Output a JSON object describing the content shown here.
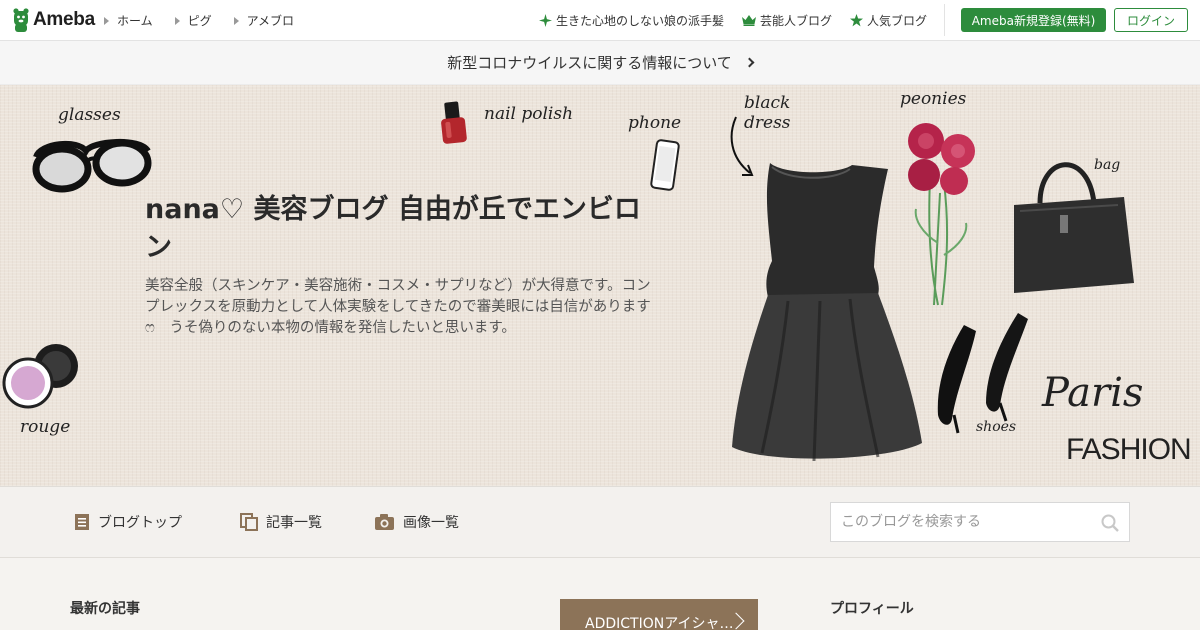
{
  "header": {
    "logo_text": "Ameba",
    "nav": [
      {
        "label": "ホーム"
      },
      {
        "label": "ピグ"
      },
      {
        "label": "アメブロ"
      }
    ],
    "right_links": [
      {
        "label": "生きた心地のしない娘の派手髪",
        "icon": "sparkle-icon"
      },
      {
        "label": "芸能人ブログ",
        "icon": "crown-icon"
      },
      {
        "label": "人気ブログ",
        "icon": "star-icon"
      }
    ],
    "register_label": "Ameba新規登録(無料)",
    "login_label": "ログイン"
  },
  "notice": {
    "text": "新型コロナウイルスに関する情報について"
  },
  "hero": {
    "title": "nana♡ 美容ブログ 自由が丘でエンビロン",
    "description": "美容全般（スキンケア・美容施術・コスメ・サプリなど）が大得意です。コンプレックスを原動力として人体実験をしてきたので審美眼には自信がありますෆ　うそ偽りのない本物の情報を発信したいと思います。",
    "illustration_labels": {
      "glasses": "glasses",
      "nail_polish": "nail polish",
      "phone": "phone",
      "black_dress": "black dress",
      "peonies": "peonies",
      "bag": "bag",
      "rouge": "rouge",
      "shoes": "shoes",
      "paris": "Paris",
      "fashion": "FASHION"
    }
  },
  "blognav": {
    "items": [
      {
        "label": "ブログトップ",
        "icon": "document-icon"
      },
      {
        "label": "記事一覧",
        "icon": "copy-icon"
      },
      {
        "label": "画像一覧",
        "icon": "camera-icon"
      }
    ],
    "search_placeholder": "このブログを検索する"
  },
  "content": {
    "latest_heading": "最新の記事",
    "featured_label": "ADDICTIONアイシャ…",
    "profile_heading": "プロフィール"
  },
  "colors": {
    "brand_green": "#2d8c3c",
    "accent_brown": "#8c7358"
  }
}
